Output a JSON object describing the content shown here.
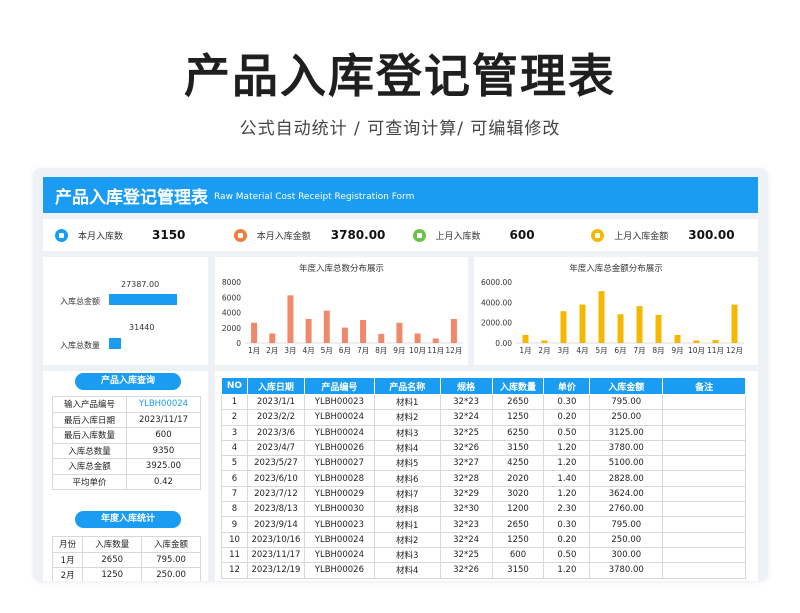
{
  "hero": {
    "title": "产品入库登记管理表",
    "subtitle": "公式自动统计  / 可查询计算/  可编辑修改"
  },
  "banner": {
    "title": "产品入库登记管理表",
    "subtitle_en": "Raw Material Cost Receipt Registration Form"
  },
  "kpis": [
    {
      "label": "本月入库数",
      "value": "3150",
      "icon": "chart-icon",
      "color": "#1a9cf2"
    },
    {
      "label": "本月入库金额",
      "value": "3780.00",
      "icon": "wallet-icon",
      "color": "#f07d3b"
    },
    {
      "label": "上月入库数",
      "value": "600",
      "icon": "box-icon",
      "color": "#6cc24a"
    },
    {
      "label": "上月入库金额",
      "value": "300.00",
      "icon": "coin-icon",
      "color": "#f5b800"
    }
  ],
  "summary_bars": {
    "items": [
      {
        "label": "入库总金额",
        "value": "27387.00",
        "raw": 27387
      },
      {
        "label": "入库总数量",
        "value": "31440",
        "raw": 31440
      }
    ]
  },
  "chart_data": [
    {
      "type": "bar",
      "title": "年度入库总数分布展示",
      "categories": [
        "1月",
        "2月",
        "3月",
        "4月",
        "5月",
        "6月",
        "7月",
        "8月",
        "9月",
        "10月",
        "11月",
        "12月"
      ],
      "values": [
        2650,
        1250,
        6250,
        3150,
        4250,
        2020,
        3020,
        1200,
        2650,
        1250,
        600,
        3150
      ],
      "yticks": [
        "0",
        "2000",
        "4000",
        "6000",
        "8000"
      ],
      "ylim": [
        0,
        8000
      ],
      "color": "#f0896a"
    },
    {
      "type": "bar",
      "title": "年度入库总金额分布展示",
      "categories": [
        "1月",
        "2月",
        "3月",
        "4月",
        "5月",
        "6月",
        "7月",
        "8月",
        "9月",
        "10月",
        "11月",
        "12月"
      ],
      "values": [
        795,
        250,
        3125,
        3780,
        5100,
        2828,
        3624,
        2760,
        795,
        250,
        300,
        3780
      ],
      "yticks": [
        "0.00",
        "2000.00",
        "4000.00",
        "6000.00"
      ],
      "ylim": [
        0,
        6000
      ],
      "color": "#f5b800"
    }
  ],
  "query": {
    "title": "产品入库查询",
    "rows": [
      {
        "k": "输入产品编号",
        "v": "YLBH00024"
      },
      {
        "k": "最后入库日期",
        "v": "2023/11/17"
      },
      {
        "k": "最后入库数量",
        "v": "600"
      },
      {
        "k": "入库总数量",
        "v": "9350"
      },
      {
        "k": "入库总金额",
        "v": "3925.00"
      },
      {
        "k": "平均单价",
        "v": "0.42"
      }
    ]
  },
  "yearly": {
    "title": "年度入库统计",
    "headers": [
      "月份",
      "入库数量",
      "入库金额"
    ],
    "rows": [
      [
        "1月",
        "2650",
        "795.00"
      ],
      [
        "2月",
        "1250",
        "250.00"
      ]
    ]
  },
  "main_table": {
    "headers": [
      "NO",
      "入库日期",
      "产品编号",
      "产品名称",
      "规格",
      "入库数量",
      "单价",
      "入库金额",
      "备注"
    ],
    "rows": [
      [
        "1",
        "2023/1/1",
        "YLBH00023",
        "材料1",
        "32*23",
        "2650",
        "0.30",
        "795.00",
        ""
      ],
      [
        "2",
        "2023/2/2",
        "YLBH00024",
        "材料2",
        "32*24",
        "1250",
        "0.20",
        "250.00",
        ""
      ],
      [
        "3",
        "2023/3/6",
        "YLBH00024",
        "材料3",
        "32*25",
        "6250",
        "0.50",
        "3125.00",
        ""
      ],
      [
        "4",
        "2023/4/7",
        "YLBH00026",
        "材料4",
        "32*26",
        "3150",
        "1.20",
        "3780.00",
        ""
      ],
      [
        "5",
        "2023/5/27",
        "YLBH00027",
        "材料5",
        "32*27",
        "4250",
        "1.20",
        "5100.00",
        ""
      ],
      [
        "6",
        "2023/6/10",
        "YLBH00028",
        "材料6",
        "32*28",
        "2020",
        "1.40",
        "2828.00",
        ""
      ],
      [
        "7",
        "2023/7/12",
        "YLBH00029",
        "材料7",
        "32*29",
        "3020",
        "1.20",
        "3624.00",
        ""
      ],
      [
        "8",
        "2023/8/13",
        "YLBH00030",
        "材料8",
        "32*30",
        "1200",
        "2.30",
        "2760.00",
        ""
      ],
      [
        "9",
        "2023/9/14",
        "YLBH00023",
        "材料1",
        "32*23",
        "2650",
        "0.30",
        "795.00",
        ""
      ],
      [
        "10",
        "2023/10/16",
        "YLBH00024",
        "材料2",
        "32*24",
        "1250",
        "0.20",
        "250.00",
        ""
      ],
      [
        "11",
        "2023/11/17",
        "YLBH00024",
        "材料3",
        "32*25",
        "600",
        "0.50",
        "300.00",
        ""
      ],
      [
        "12",
        "2023/12/19",
        "YLBH00026",
        "材料4",
        "32*26",
        "3150",
        "1.20",
        "3780.00",
        ""
      ]
    ]
  }
}
